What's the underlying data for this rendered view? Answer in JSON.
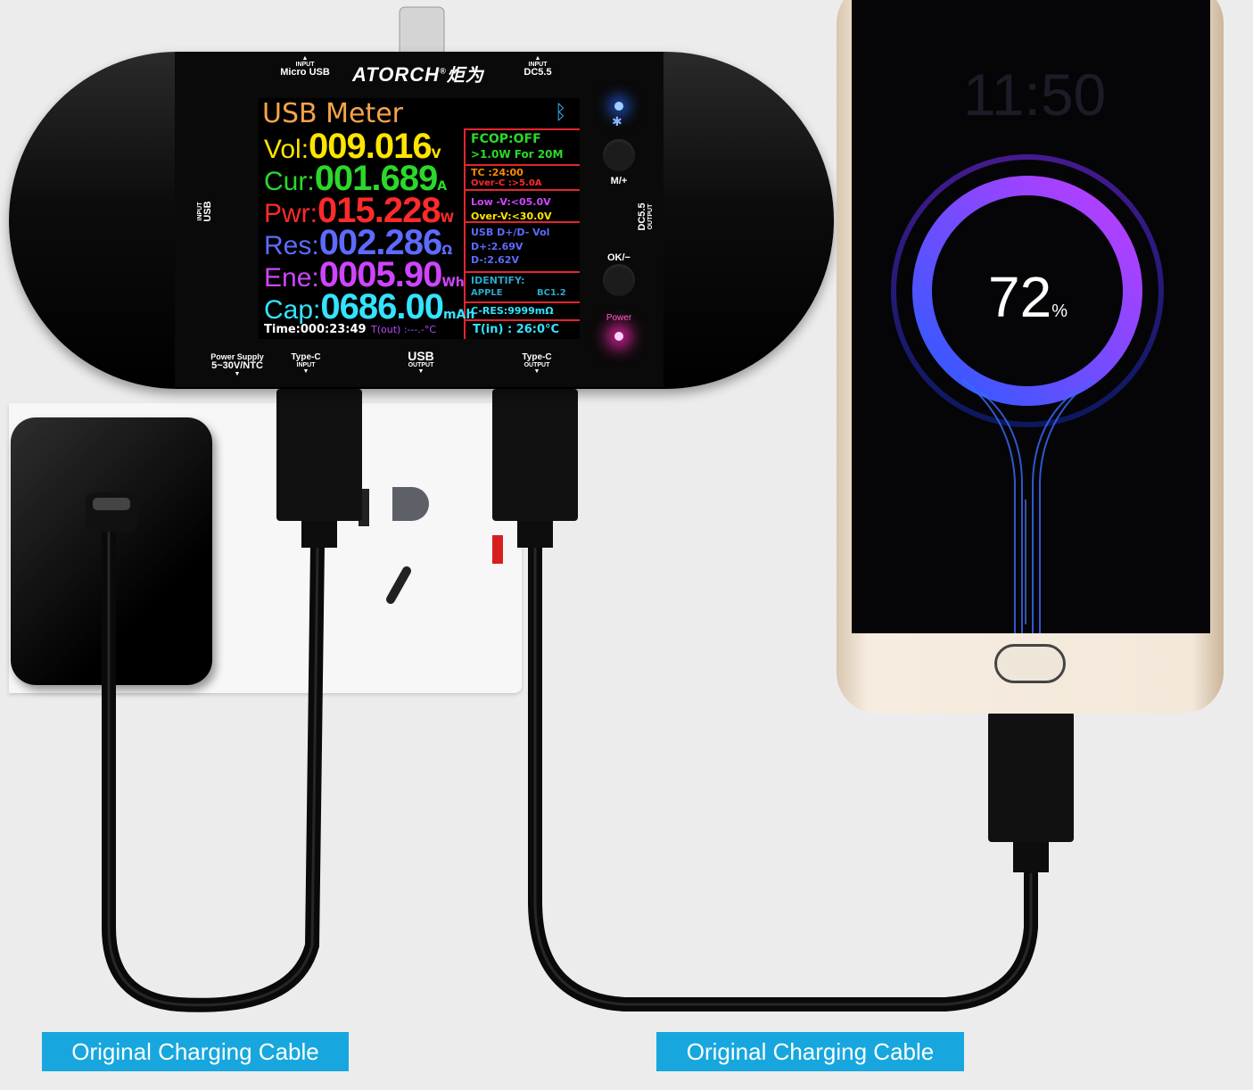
{
  "device": {
    "brand": "ATORCH",
    "brand_cjk": "炬为",
    "ports": {
      "top_left": {
        "small": "INPUT",
        "main": "Micro USB"
      },
      "top_right": {
        "small": "INPUT",
        "main": "DC5.5"
      },
      "left": {
        "small": "INPUT",
        "main": "USB"
      },
      "right": {
        "small": "OUTPUT",
        "main": "DC5.5"
      },
      "bottom_1": {
        "main": "Power Supply",
        "sub": "5~30V/NTC"
      },
      "bottom_2": {
        "main": "Type-C",
        "small": "INPUT"
      },
      "bottom_3": {
        "main": "USB",
        "small": "OUTPUT"
      },
      "bottom_4": {
        "main": "Type-C",
        "small": "OUTPUT"
      }
    },
    "buttons": {
      "m_plus": "M/+",
      "ok_minus": "OK/−",
      "power": "Power"
    }
  },
  "screen": {
    "title": "USB Meter",
    "readings": [
      {
        "name": "Vol:",
        "value": "009.016",
        "unit": "V",
        "color": "#ffe500"
      },
      {
        "name": "Cur:",
        "value": "001.689",
        "unit": "A",
        "color": "#2bd82b"
      },
      {
        "name": "Pwr:",
        "value": "015.228",
        "unit": "W",
        "color": "#ff2a2a"
      },
      {
        "name": "Res:",
        "value": "002.286",
        "unit": "Ω",
        "color": "#5d6bff"
      },
      {
        "name": "Ene:",
        "value": "0005.90",
        "unit": "Wh",
        "color": "#cf45ff"
      },
      {
        "name": "Cap:",
        "value": "0686.00",
        "unit": "mAh",
        "color": "#34e3ff"
      }
    ],
    "time": "Time:000:23:49",
    "tout": "T(out) :---.-°C",
    "side": {
      "fcop": "FCOP:OFF",
      "fcop_detail": ">1.0W  For  20M",
      "tc": "TC  :24:00",
      "overc": "Over-C :>5.0A",
      "lowv": "Low  -V:<05.0V",
      "overv": "Over-V:<30.0V",
      "usb_dd": "USB D+/D- Vol",
      "dplus": "D+:2.69V",
      "dminus": "D-:2.62V",
      "identify": "IDENTIFY:",
      "apple": "APPLE",
      "bc": "BC1.2",
      "cres": "C-RES:9999mΩ",
      "tin": "T(in)  : 26:0°C"
    }
  },
  "phone": {
    "clock": "11:50",
    "battery_number": "72",
    "battery_unit": "%"
  },
  "captions": {
    "left": "Original Charging Cable",
    "right": "Original Charging Cable"
  }
}
